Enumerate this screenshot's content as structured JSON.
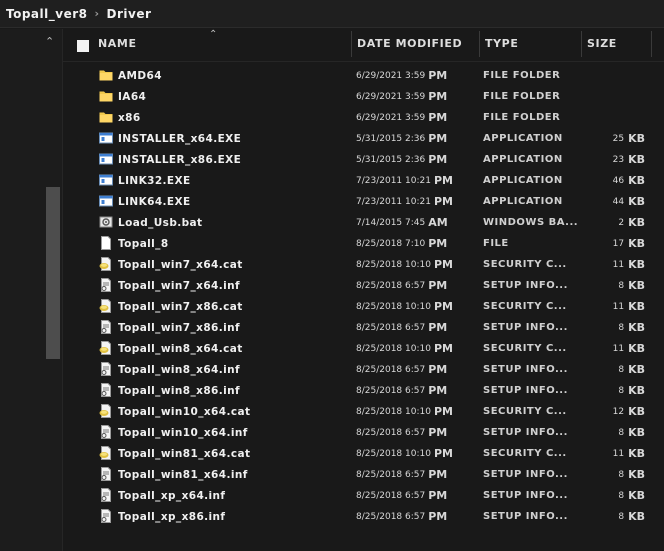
{
  "breadcrumb": {
    "items": [
      "Topall_ver8",
      "Driver"
    ],
    "separator": "›"
  },
  "columns": {
    "name": "Name",
    "date": "Date modified",
    "type": "Type",
    "size": "Size"
  },
  "files": [
    {
      "name": "AMD64",
      "date": "6/29/2021 3:59",
      "ampm": "PM",
      "type": "File folder",
      "size": "",
      "unit": "",
      "icon": "folder"
    },
    {
      "name": "IA64",
      "date": "6/29/2021 3:59",
      "ampm": "PM",
      "type": "File folder",
      "size": "",
      "unit": "",
      "icon": "folder"
    },
    {
      "name": "x86",
      "date": "6/29/2021 3:59",
      "ampm": "PM",
      "type": "File folder",
      "size": "",
      "unit": "",
      "icon": "folder"
    },
    {
      "name": "INSTALLER_x64.EXE",
      "date": "5/31/2015 2:36",
      "ampm": "PM",
      "type": "Application",
      "size": "25",
      "unit": "KB",
      "icon": "app"
    },
    {
      "name": "INSTALLER_x86.EXE",
      "date": "5/31/2015 2:36",
      "ampm": "PM",
      "type": "Application",
      "size": "23",
      "unit": "KB",
      "icon": "app"
    },
    {
      "name": "LINK32.EXE",
      "date": "7/23/2011 10:21",
      "ampm": "PM",
      "type": "Application",
      "size": "46",
      "unit": "KB",
      "icon": "app"
    },
    {
      "name": "LINK64.EXE",
      "date": "7/23/2011 10:21",
      "ampm": "PM",
      "type": "Application",
      "size": "44",
      "unit": "KB",
      "icon": "app"
    },
    {
      "name": "Load_Usb.bat",
      "date": "7/14/2015 7:45",
      "ampm": "AM",
      "type": "Windows Ba...",
      "size": "2",
      "unit": "KB",
      "icon": "bat"
    },
    {
      "name": "Topall_8",
      "date": "8/25/2018 7:10",
      "ampm": "PM",
      "type": "File",
      "size": "17",
      "unit": "KB",
      "icon": "file"
    },
    {
      "name": "Topall_win7_x64.cat",
      "date": "8/25/2018 10:10",
      "ampm": "PM",
      "type": "Security C...",
      "size": "11",
      "unit": "KB",
      "icon": "cat"
    },
    {
      "name": "Topall_win7_x64.inf",
      "date": "8/25/2018 6:57",
      "ampm": "PM",
      "type": "Setup Info...",
      "size": "8",
      "unit": "KB",
      "icon": "inf"
    },
    {
      "name": "Topall_win7_x86.cat",
      "date": "8/25/2018 10:10",
      "ampm": "PM",
      "type": "Security C...",
      "size": "11",
      "unit": "KB",
      "icon": "cat"
    },
    {
      "name": "Topall_win7_x86.inf",
      "date": "8/25/2018 6:57",
      "ampm": "PM",
      "type": "Setup Info...",
      "size": "8",
      "unit": "KB",
      "icon": "inf"
    },
    {
      "name": "Topall_win8_x64.cat",
      "date": "8/25/2018 10:10",
      "ampm": "PM",
      "type": "Security C...",
      "size": "11",
      "unit": "KB",
      "icon": "cat"
    },
    {
      "name": "Topall_win8_x64.inf",
      "date": "8/25/2018 6:57",
      "ampm": "PM",
      "type": "Setup Info...",
      "size": "8",
      "unit": "KB",
      "icon": "inf"
    },
    {
      "name": "Topall_win8_x86.inf",
      "date": "8/25/2018 6:57",
      "ampm": "PM",
      "type": "Setup Info...",
      "size": "8",
      "unit": "KB",
      "icon": "inf"
    },
    {
      "name": "Topall_win10_x64.cat",
      "date": "8/25/2018 10:10",
      "ampm": "PM",
      "type": "Security C...",
      "size": "12",
      "unit": "KB",
      "icon": "cat"
    },
    {
      "name": "Topall_win10_x64.inf",
      "date": "8/25/2018 6:57",
      "ampm": "PM",
      "type": "Setup Info...",
      "size": "8",
      "unit": "KB",
      "icon": "inf"
    },
    {
      "name": "Topall_win81_x64.cat",
      "date": "8/25/2018 10:10",
      "ampm": "PM",
      "type": "Security C...",
      "size": "11",
      "unit": "KB",
      "icon": "cat"
    },
    {
      "name": "Topall_win81_x64.inf",
      "date": "8/25/2018 6:57",
      "ampm": "PM",
      "type": "Setup Info...",
      "size": "8",
      "unit": "KB",
      "icon": "inf"
    },
    {
      "name": "Topall_xp_x64.inf",
      "date": "8/25/2018 6:57",
      "ampm": "PM",
      "type": "Setup Info...",
      "size": "8",
      "unit": "KB",
      "icon": "inf"
    },
    {
      "name": "Topall_xp_x86.inf",
      "date": "8/25/2018 6:57",
      "ampm": "PM",
      "type": "Setup Info...",
      "size": "8",
      "unit": "KB",
      "icon": "inf"
    }
  ]
}
